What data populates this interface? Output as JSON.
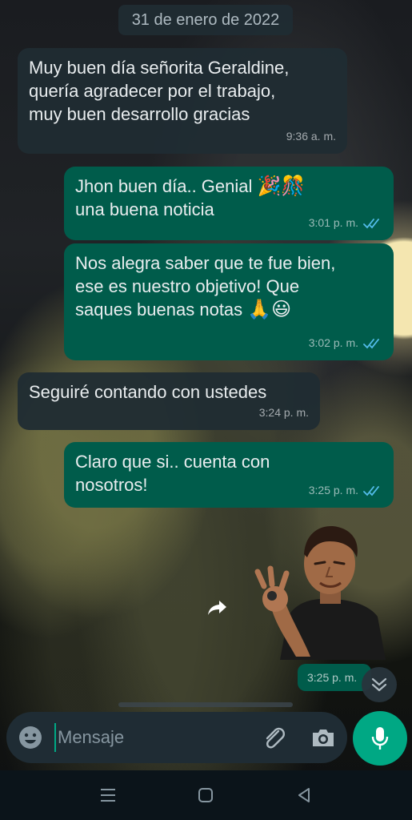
{
  "date_separator": "31 de enero de 2022",
  "messages": [
    {
      "direction": "in",
      "text": "Muy buen día señorita Geraldine,\nquería agradecer por el trabajo,\nmuy buen desarrollo gracias",
      "time": "9:36 a. m."
    },
    {
      "direction": "out",
      "text": "Jhon buen día.. Genial",
      "emojis": "🎉🎊",
      "text2": "una buena noticia",
      "time": "3:01 p. m.",
      "status": "read"
    },
    {
      "direction": "out",
      "text": "Nos alegra saber que te fue bien,\nese es nuestro objetivo! Que\nsaques buenas notas",
      "emojis": "🙏😃",
      "time": "3:02 p. m.",
      "status": "read"
    },
    {
      "direction": "in",
      "text": "Seguiré contando con ustedes",
      "time": "3:24 p. m."
    },
    {
      "direction": "out",
      "text": "Claro que si.. cuenta con\nnosotros!",
      "time": "3:25 p. m.",
      "status": "read"
    }
  ],
  "sticker": {
    "description_icon": "sticker-man-ok-hand",
    "time": "3:25 p. m."
  },
  "composer": {
    "placeholder": "Mensaje",
    "emoji_icon": "emoji-icon",
    "attach_icon": "paperclip-icon",
    "camera_icon": "camera-icon",
    "mic_icon": "mic-icon"
  },
  "colors": {
    "incoming_bubble": "#202c33",
    "outgoing_bubble": "#005c4b",
    "accent": "#00a884",
    "read_ticks": "#53bdeb"
  },
  "navbar": {
    "icons": [
      "menu-icon",
      "home-icon",
      "back-icon"
    ]
  }
}
